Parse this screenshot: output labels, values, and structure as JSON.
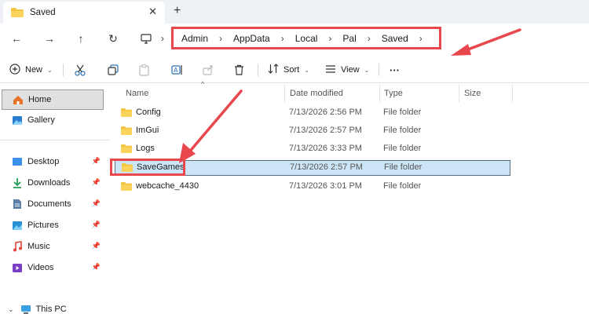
{
  "tab": {
    "title": "Saved",
    "close": "✕",
    "new": "+"
  },
  "nav": {
    "back": "←",
    "forward": "→",
    "up": "↑",
    "refresh": "↻"
  },
  "breadcrumb": [
    "Admin",
    "AppData",
    "Local",
    "Pal",
    "Saved"
  ],
  "toolbar": {
    "new_label": "New",
    "sort_label": "Sort",
    "view_label": "View",
    "more_label": "···"
  },
  "sidebar": {
    "items": [
      {
        "label": "Home"
      },
      {
        "label": "Gallery"
      },
      {
        "label": "Desktop"
      },
      {
        "label": "Downloads"
      },
      {
        "label": "Documents"
      },
      {
        "label": "Pictures"
      },
      {
        "label": "Music"
      },
      {
        "label": "Videos"
      },
      {
        "label": "This PC"
      }
    ]
  },
  "columns": {
    "name": "Name",
    "date": "Date modified",
    "type": "Type",
    "size": "Size"
  },
  "files": [
    {
      "name": "Config",
      "date": "7/13/2026 2:56 PM",
      "type": "File folder"
    },
    {
      "name": "ImGui",
      "date": "7/13/2026 2:57 PM",
      "type": "File folder"
    },
    {
      "name": "Logs",
      "date": "7/13/2026 3:33 PM",
      "type": "File folder"
    },
    {
      "name": "SaveGames",
      "date": "7/13/2026 2:57 PM",
      "type": "File folder"
    },
    {
      "name": "webcache_4430",
      "date": "7/13/2026 3:01 PM",
      "type": "File folder"
    }
  ],
  "colors": {
    "annotation": "#e8474d",
    "folder": "#f4c542",
    "selection": "#cde6f7"
  }
}
